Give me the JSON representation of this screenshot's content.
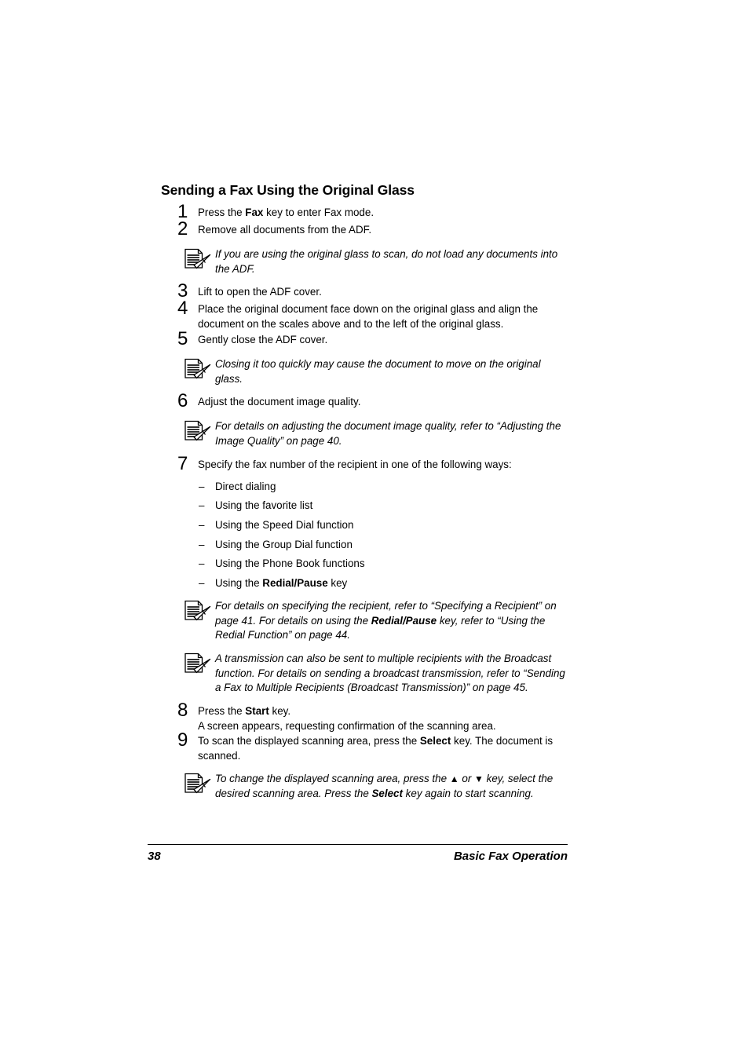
{
  "document": {
    "section_title": "Sending a Fax Using the Original Glass",
    "footer": {
      "page_number": "38",
      "chapter_title": "Basic Fax Operation"
    }
  },
  "steps": [
    {
      "number": "1",
      "text_before": "Press the ",
      "bold": "Fax",
      "text_after": " key to enter Fax mode."
    },
    {
      "number": "2",
      "text_before": "Remove all documents from the ADF.",
      "bold": "",
      "text_after": ""
    },
    {
      "number": "3",
      "text_before": "Lift to open the ADF cover.",
      "bold": "",
      "text_after": ""
    },
    {
      "number": "4",
      "text_before": "Place the original document face down on the original glass and align the document on the scales above and to the left of the original glass.",
      "bold": "",
      "text_after": ""
    },
    {
      "number": "5",
      "text_before": "Gently close the ADF cover.",
      "bold": "",
      "text_after": ""
    },
    {
      "number": "6",
      "text_before": "Adjust the document image quality.",
      "bold": "",
      "text_after": ""
    },
    {
      "number": "7",
      "text_before": "Specify the fax number of the recipient in one of the following ways:",
      "bold": "",
      "text_after": ""
    },
    {
      "number": "8",
      "text_before": "Press the ",
      "bold": "Start",
      "text_after": " key.",
      "subline": "A screen appears, requesting confirmation of the scanning area."
    },
    {
      "number": "9",
      "text_before": "To scan the displayed scanning area, press the ",
      "bold": "Select",
      "text_after": " key. The document is scanned."
    }
  ],
  "notes": [
    {
      "icon": "note-pencil-icon",
      "parts": [
        {
          "style": "italic",
          "text": "If you are using the original glass to scan, do not load any documents into the ADF."
        }
      ]
    },
    {
      "icon": "note-pencil-icon",
      "parts": [
        {
          "style": "italic",
          "text": "Closing it too quickly may cause the document to move on the original glass."
        }
      ]
    },
    {
      "icon": "note-pencil-icon",
      "parts": [
        {
          "style": "italic",
          "text": "For details on adjusting the document image quality, refer to “Adjusting the Image Quality” on page 40."
        }
      ]
    },
    {
      "icon": "note-pencil-icon",
      "parts": [
        {
          "style": "italic",
          "text": "For details on specifying the recipient, refer to “Specifying a Recipient” on page 41. For details on using the "
        },
        {
          "style": "italic-bold",
          "text": "Redial/Pause"
        },
        {
          "style": "italic",
          "text": " key, refer to “Using the Redial Function” on page 44."
        }
      ]
    },
    {
      "icon": "note-pencil-icon",
      "parts": [
        {
          "style": "italic",
          "text": "A transmission can also be sent to multiple recipients with the Broadcast function. For details on sending a broadcast transmission, refer to “Sending a Fax to Multiple Recipients (Broadcast Transmission)” on page 45."
        }
      ]
    },
    {
      "icon": "note-pencil-icon",
      "parts": [
        {
          "style": "italic",
          "text": "To change the displayed scanning area, press the "
        },
        {
          "style": "glyph",
          "text": "▲"
        },
        {
          "style": "italic",
          "text": " or "
        },
        {
          "style": "glyph",
          "text": "▼"
        },
        {
          "style": "italic",
          "text": " key, select the desired scanning area. Press the "
        },
        {
          "style": "italic-bold",
          "text": "Select"
        },
        {
          "style": "italic",
          "text": " key again to start scanning."
        }
      ]
    }
  ],
  "dial_methods": {
    "dash": "–",
    "items": [
      {
        "text_before": "Direct dialing",
        "bold": "",
        "text_after": ""
      },
      {
        "text_before": "Using the favorite list",
        "bold": "",
        "text_after": ""
      },
      {
        "text_before": "Using the Speed Dial function",
        "bold": "",
        "text_after": ""
      },
      {
        "text_before": "Using the Group Dial function",
        "bold": "",
        "text_after": ""
      },
      {
        "text_before": "Using the Phone Book functions",
        "bold": "",
        "text_after": ""
      },
      {
        "text_before": "Using the ",
        "bold": "Redial/Pause",
        "text_after": " key"
      }
    ]
  },
  "colors": {
    "text": "#000000",
    "background": "#ffffff"
  }
}
